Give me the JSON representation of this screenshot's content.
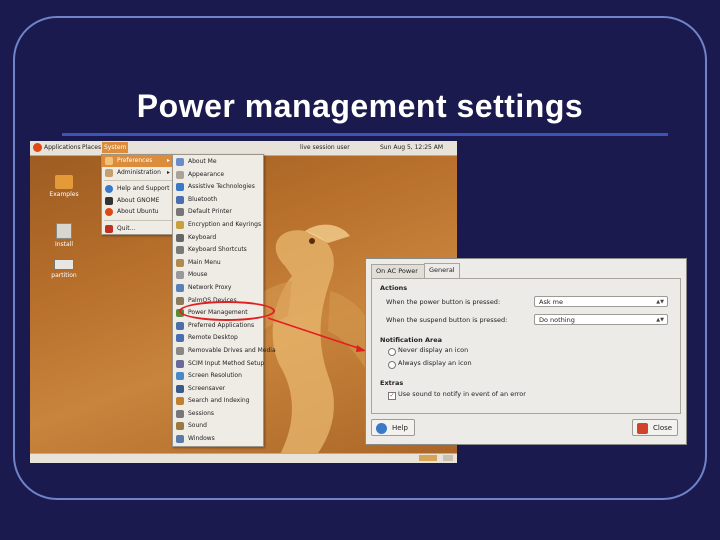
{
  "slide": {
    "title": "Power management settings"
  },
  "topbar": {
    "menus": [
      "Applications",
      "Places",
      "System"
    ],
    "clock": "Sun Aug 5, 12:25 AM",
    "user": "live session user"
  },
  "desktop_icons": [
    "Examples",
    "Install",
    "partition"
  ],
  "system_menu": {
    "items": [
      {
        "label": "Preferences",
        "submenu": true,
        "icon": "folder-icon"
      },
      {
        "label": "Administration",
        "submenu": true,
        "icon": "folder-icon"
      },
      {
        "label": "Help and Support",
        "icon": "help-icon"
      },
      {
        "label": "About GNOME",
        "icon": "gnome-icon"
      },
      {
        "label": "About Ubuntu",
        "icon": "ubuntu-icon"
      },
      {
        "label": "Quit...",
        "icon": "quit-icon"
      }
    ]
  },
  "preferences_menu": {
    "items": [
      "About Me",
      "Appearance",
      "Assistive Technologies",
      "Bluetooth",
      "Default Printer",
      "Encryption and Keyrings",
      "Keyboard",
      "Keyboard Shortcuts",
      "Main Menu",
      "Mouse",
      "Network Proxy",
      "PalmOS Devices",
      "Power Management",
      "Preferred Applications",
      "Remote Desktop",
      "Removable Drives and Media",
      "SCIM Input Method Setup",
      "Screen Resolution",
      "Screensaver",
      "Search and Indexing",
      "Sessions",
      "Sound",
      "Windows"
    ],
    "highlighted": "Power Management"
  },
  "dialog": {
    "tabs": [
      "On AC Power",
      "General"
    ],
    "active_tab": "General",
    "actions_heading": "Actions",
    "power_button_label": "When the power button is pressed:",
    "power_button_value": "Ask me",
    "suspend_button_label": "When the suspend button is pressed:",
    "suspend_button_value": "Do nothing",
    "notification_heading": "Notification Area",
    "radio_never": "Never display an icon",
    "radio_always": "Always display an icon",
    "extras_heading": "Extras",
    "extras_check": "Use sound to notify in event of an error",
    "extras_checked": true,
    "help_label": "Help",
    "close_label": "Close"
  },
  "colors": {
    "background": "#1a1a4e",
    "highlight": "#dc8d3b",
    "annotation": "#e02020"
  }
}
